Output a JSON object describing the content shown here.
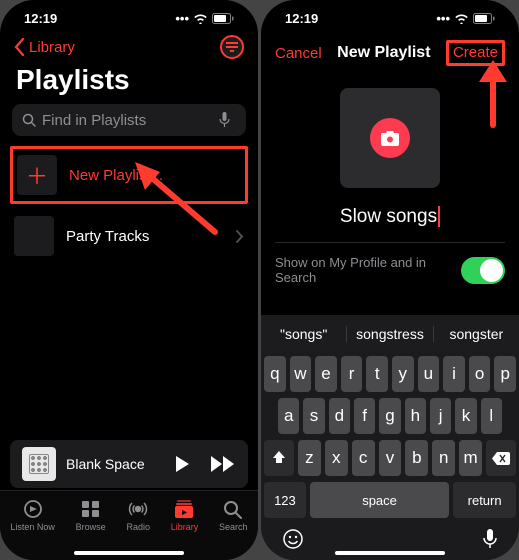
{
  "statusbar": {
    "time": "12:19"
  },
  "left": {
    "back_label": "Library",
    "title": "Playlists",
    "search_placeholder": "Find in Playlists",
    "new_playlist_label": "New Playlist...",
    "playlist_items": [
      {
        "label": "Party Tracks"
      }
    ],
    "now_playing": "Blank Space",
    "tabs": [
      {
        "label": "Listen Now"
      },
      {
        "label": "Browse"
      },
      {
        "label": "Radio"
      },
      {
        "label": "Library"
      },
      {
        "label": "Search"
      }
    ]
  },
  "right": {
    "cancel_label": "Cancel",
    "header_title": "New Playlist",
    "create_label": "Create",
    "playlist_name_value": "Slow songs",
    "toggle_label": "Show on My Profile and in Search",
    "toggle_on": true,
    "suggestions": [
      "\"songs\"",
      "songstress",
      "songster"
    ],
    "keyboard": {
      "row1": [
        "q",
        "w",
        "e",
        "r",
        "t",
        "y",
        "u",
        "i",
        "o",
        "p"
      ],
      "row2": [
        "a",
        "s",
        "d",
        "f",
        "g",
        "h",
        "j",
        "k",
        "l"
      ],
      "row3": [
        "z",
        "x",
        "c",
        "v",
        "b",
        "n",
        "m"
      ],
      "num_key": "123",
      "space_key": "space",
      "return_key": "return"
    }
  }
}
